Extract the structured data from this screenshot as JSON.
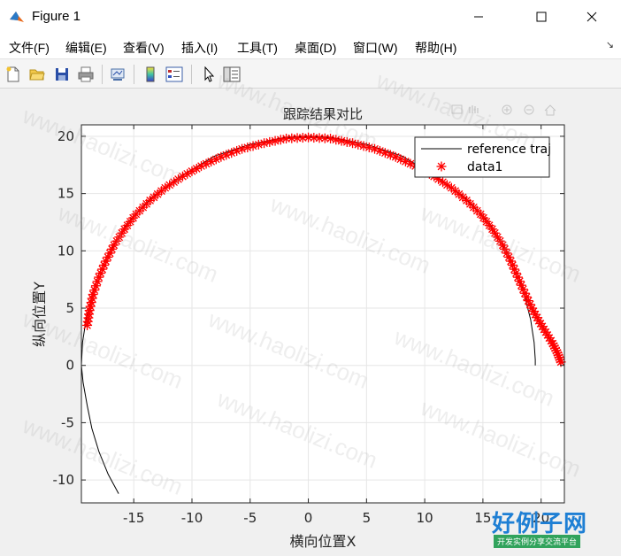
{
  "window": {
    "title": "Figure 1",
    "minimize_label": "—",
    "maximize_label": "☐",
    "close_label": "✕"
  },
  "menu": {
    "items": [
      "文件(F)",
      "编辑(E)",
      "查看(V)",
      "插入(I)",
      "工具(T)",
      "桌面(D)",
      "窗口(W)",
      "帮助(H)"
    ],
    "dock_arrow": "↘"
  },
  "toolbar": {
    "buttons": [
      "new-figure",
      "open-file",
      "save",
      "print",
      "link-plot",
      "colorbar",
      "legend",
      "edit-plot-pointer",
      "property-inspector"
    ]
  },
  "axes_toolbar": {
    "icons": [
      "data-tip",
      "pan",
      "zoom-in",
      "zoom-out",
      "home"
    ]
  },
  "watermark_text": "www.haolizi.com",
  "logo": {
    "main": "好例子网",
    "sub": "开发实例分享交流平台"
  },
  "colors": {
    "reference": "#000000",
    "data1": "#ff0000",
    "grid": "#e6e6e6",
    "axes_bg": "#ffffff"
  },
  "chart_data": {
    "type": "line",
    "title": "跟踪结果对比",
    "xlabel": "横向位置X",
    "ylabel": "纵向位置Y",
    "xlim": [
      -19.5,
      22
    ],
    "ylim": [
      -12,
      21
    ],
    "xticks": [
      -15,
      -10,
      -5,
      0,
      5,
      10,
      15,
      20
    ],
    "yticks": [
      -10,
      -5,
      0,
      5,
      10,
      15,
      20
    ],
    "grid": true,
    "legend": {
      "location": "top-right",
      "entries": [
        "reference traj",
        "data1"
      ]
    },
    "series": [
      {
        "name": "reference traj",
        "style": "solid-line",
        "color": "#000000",
        "x": [
          -16.3,
          -17.2,
          -18.0,
          -18.6,
          -19.0,
          -19.35,
          -19.5,
          -19.4,
          -19.1,
          -18.6,
          -18.0,
          -17.0,
          -15.5,
          -13.5,
          -11.0,
          -8.0,
          -5.0,
          -2.0,
          0.0,
          2.0,
          5.0,
          8.0,
          11.0,
          13.5,
          15.5,
          17.0,
          18.0,
          18.6,
          19.1,
          19.4,
          19.5,
          19.5
        ],
        "y": [
          -11.2,
          -9.5,
          -7.5,
          -5.5,
          -3.5,
          -1.5,
          0.0,
          2.0,
          4.0,
          6.0,
          8.0,
          10.0,
          12.5,
          14.6,
          16.5,
          18.3,
          19.3,
          19.9,
          20.0,
          19.9,
          19.3,
          18.3,
          16.5,
          14.6,
          12.5,
          10.0,
          8.0,
          6.0,
          4.0,
          2.0,
          0.5,
          0.0
        ]
      },
      {
        "name": "data1",
        "style": "asterisk-markers",
        "color": "#ff0000",
        "x": [
          -19.0,
          -18.8,
          -18.5,
          -18.0,
          -17.4,
          -16.7,
          -15.8,
          -14.8,
          -13.6,
          -12.3,
          -10.8,
          -9.2,
          -7.5,
          -5.7,
          -3.8,
          -1.9,
          0.0,
          1.9,
          3.8,
          5.7,
          7.5,
          9.2,
          10.8,
          12.3,
          13.6,
          14.8,
          15.8,
          16.7,
          17.4,
          18.0,
          18.6,
          19.2,
          19.8,
          20.4,
          21.0,
          21.4,
          21.7
        ],
        "y": [
          3.5,
          4.8,
          6.2,
          7.7,
          9.1,
          10.5,
          11.9,
          13.2,
          14.4,
          15.5,
          16.5,
          17.4,
          18.2,
          18.9,
          19.4,
          19.8,
          19.9,
          19.8,
          19.4,
          18.9,
          18.2,
          17.4,
          16.5,
          15.5,
          14.4,
          13.2,
          11.9,
          10.5,
          9.1,
          7.7,
          6.3,
          5.0,
          3.9,
          2.9,
          1.9,
          1.1,
          0.3
        ]
      }
    ]
  }
}
